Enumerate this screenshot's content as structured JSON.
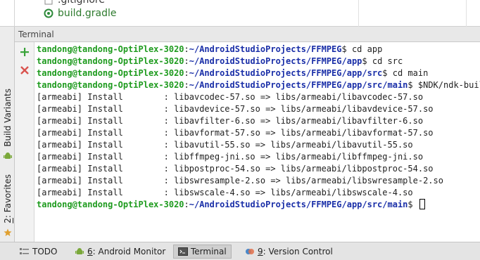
{
  "project_tree": {
    "items": [
      {
        "label": ".gitignore",
        "icon": "file-icon"
      },
      {
        "label": "build.gradle",
        "icon": "gradle-icon"
      }
    ]
  },
  "left_strip": {
    "build_variants": "Build Variants",
    "favorites_mnemonic": "2",
    "favorites": ": Favorites"
  },
  "terminal": {
    "title": "Terminal",
    "prompt_user": "tandong@tandong-OptiPlex-3020",
    "lines": [
      {
        "path": "~/AndroidStudioProjects/FFMPEG",
        "cmd": "$ cd app"
      },
      {
        "path": "~/AndroidStudioProjects/FFMPEG/app",
        "cmd": "$ cd src"
      },
      {
        "path": "~/AndroidStudioProjects/FFMPEG/app/src",
        "cmd": "$ cd main"
      },
      {
        "path": "~/AndroidStudioProjects/FFMPEG/app/src/main",
        "cmd": "$ $NDK/ndk-build"
      }
    ],
    "output": [
      "[armeabi] Install        : libavcodec-57.so => libs/armeabi/libavcodec-57.so",
      "[armeabi] Install        : libavdevice-57.so => libs/armeabi/libavdevice-57.so",
      "[armeabi] Install        : libavfilter-6.so => libs/armeabi/libavfilter-6.so",
      "[armeabi] Install        : libavformat-57.so => libs/armeabi/libavformat-57.so",
      "[armeabi] Install        : libavutil-55.so => libs/armeabi/libavutil-55.so",
      "[armeabi] Install        : libffmpeg-jni.so => libs/armeabi/libffmpeg-jni.so",
      "[armeabi] Install        : libpostproc-54.so => libs/armeabi/libpostproc-54.so",
      "[armeabi] Install        : libswresample-2.so => libs/armeabi/libswresample-2.so",
      "[armeabi] Install        : libswscale-4.so => libs/armeabi/libswscale-4.so"
    ],
    "final_prompt": {
      "path": "~/AndroidStudioProjects/FFMPEG/app/src/main",
      "cmd": "$ "
    }
  },
  "bottom_bar": {
    "tabs": [
      {
        "label": "TODO",
        "mnemonic": "",
        "icon": "todo-icon"
      },
      {
        "label": ": Android Monitor",
        "mnemonic": "6",
        "icon": "android-icon"
      },
      {
        "label": "Terminal",
        "mnemonic": "",
        "icon": "terminal-icon",
        "active": true
      },
      {
        "label": ": Version Control",
        "mnemonic": "9",
        "icon": "version-control-icon"
      }
    ]
  },
  "colors": {
    "prompt_user": "#1e9b1e",
    "prompt_path": "#1a2fa8",
    "gradle_text": "#2d7a2d",
    "add_icon": "#3aa33a",
    "close_icon": "#d9534f"
  }
}
